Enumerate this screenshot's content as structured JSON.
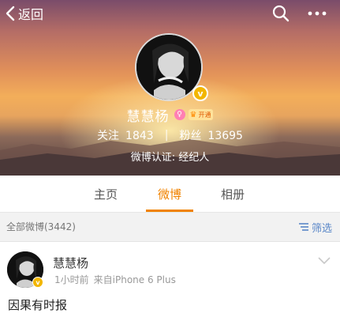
{
  "header": {
    "back_label": "返回",
    "icons": {
      "back": "chevron-left-icon",
      "search": "search-icon",
      "more": "more-dots-icon"
    }
  },
  "profile": {
    "nickname": "慧慧杨",
    "vip_text": "开通",
    "verify_mark": "v",
    "following_label": "关注",
    "following_count": "1843",
    "separator": "|",
    "followers_label": "粉丝",
    "followers_count": "13695",
    "verification": "微博认证: 经纪人"
  },
  "tabs": [
    {
      "label": "主页",
      "active": false
    },
    {
      "label": "微博",
      "active": true
    },
    {
      "label": "相册",
      "active": false
    }
  ],
  "filter": {
    "count_text": "全部微博(3442)",
    "filter_label": "筛选"
  },
  "post": {
    "author": "慧慧杨",
    "verify_mark": "v",
    "time": "1小时前",
    "source": "来自iPhone 6 Plus",
    "text": "因果有时报"
  },
  "colors": {
    "accent": "#f08300",
    "link": "#5a87c8",
    "verify": "#f2b600"
  }
}
